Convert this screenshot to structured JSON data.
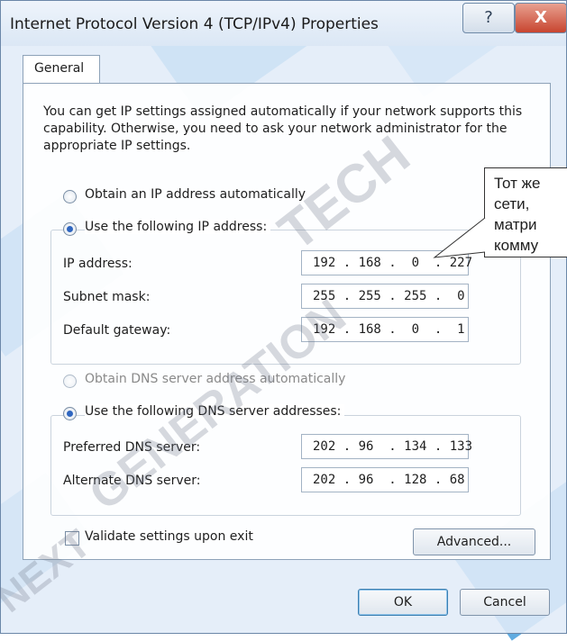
{
  "window": {
    "title": "Internet Protocol Version 4 (TCP/IPv4) Properties",
    "help_glyph": "?",
    "close_glyph": "X"
  },
  "tabs": [
    {
      "label": "General"
    }
  ],
  "intro_text": "You can get IP settings assigned automatically if your network supports this capability. Otherwise, you need to ask your network administrator for the appropriate IP settings.",
  "ip_section": {
    "auto_label": "Obtain an IP address automatically",
    "manual_label": "Use the following IP address:",
    "selected": "manual",
    "fields": [
      {
        "label": "IP address:",
        "value": "192 . 168 .  0  . 227"
      },
      {
        "label": "Subnet mask:",
        "value": "255 . 255 . 255 .  0"
      },
      {
        "label": "Default gateway:",
        "value": "192 . 168 .  0  .  1"
      }
    ]
  },
  "dns_section": {
    "auto_label": "Obtain DNS server address automatically",
    "manual_label": "Use the following DNS server addresses:",
    "selected": "manual",
    "fields": [
      {
        "label": "Preferred DNS server:",
        "value": "202 . 96  . 134 . 133"
      },
      {
        "label": "Alternate DNS server:",
        "value": "202 . 96  . 128 . 68"
      }
    ]
  },
  "validate": {
    "label": "Validate settings upon exit",
    "checked": false
  },
  "buttons": {
    "advanced": "Advanced...",
    "ok": "OK",
    "cancel": "Cancel"
  },
  "callout": {
    "lines": [
      "Тот же",
      "сети,",
      "матри",
      "комму"
    ]
  },
  "watermark": {
    "top": "TECH",
    "middle": "GENERATION",
    "bottom": "NEXT"
  },
  "colors": {
    "accent_blue": "#2b8fd6",
    "radio_dot": "#2f66c0",
    "close_red": "#c8452f"
  }
}
